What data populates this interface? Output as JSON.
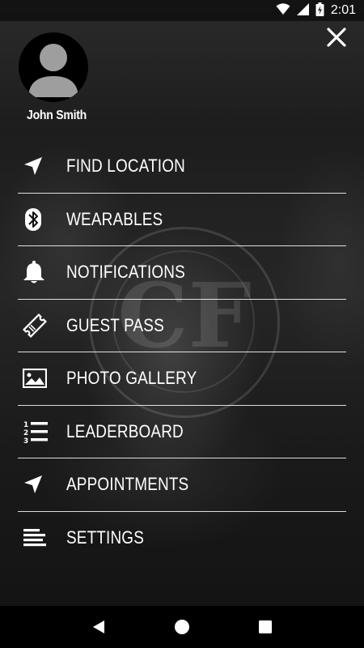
{
  "status_bar": {
    "time": "2:01"
  },
  "watermark_text": "CF",
  "profile": {
    "name": "John Smith"
  },
  "menu": {
    "items": [
      {
        "label": "FIND LOCATION",
        "icon": "navigation-arrow-icon"
      },
      {
        "label": "WEARABLES",
        "icon": "bluetooth-icon"
      },
      {
        "label": "NOTIFICATIONS",
        "icon": "bell-icon"
      },
      {
        "label": "GUEST PASS",
        "icon": "ticket-icon"
      },
      {
        "label": "PHOTO GALLERY",
        "icon": "image-icon"
      },
      {
        "label": "LEADERBOARD",
        "icon": "numbered-list-icon"
      },
      {
        "label": "APPOINTMENTS",
        "icon": "navigation-arrow-icon"
      },
      {
        "label": "SETTINGS",
        "icon": "text-lines-icon"
      }
    ]
  },
  "colors": {
    "text": "#ffffff",
    "overlay": "#000000",
    "divider": "#ffffff"
  }
}
